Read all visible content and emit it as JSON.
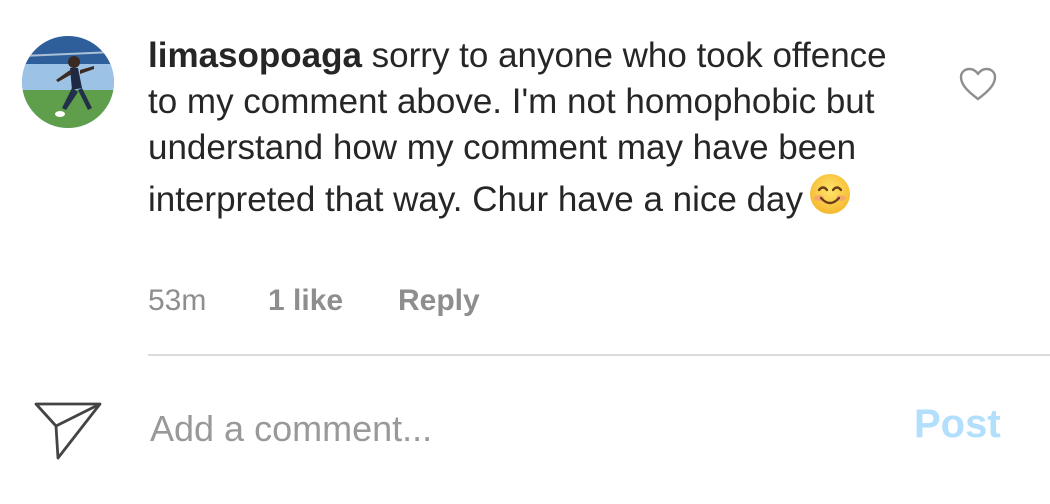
{
  "comment": {
    "username": "limasopoaga",
    "text": " sorry to anyone who took offence to my comment above. I'm not homophobic but understand how my comment may have been interpreted that way. Chur have a nice day",
    "emoji": "smiling-face-emoji",
    "time": "53m",
    "likes": "1 like",
    "reply_label": "Reply",
    "like_icon": "heart-outline-icon"
  },
  "composer": {
    "send_icon": "paper-plane-icon",
    "placeholder": "Add a comment...",
    "value": "",
    "post_label": "Post"
  },
  "colors": {
    "text": "#262626",
    "secondary": "#8e8e8e",
    "post_disabled": "#b2dffc",
    "divider": "#dbdbdb"
  }
}
